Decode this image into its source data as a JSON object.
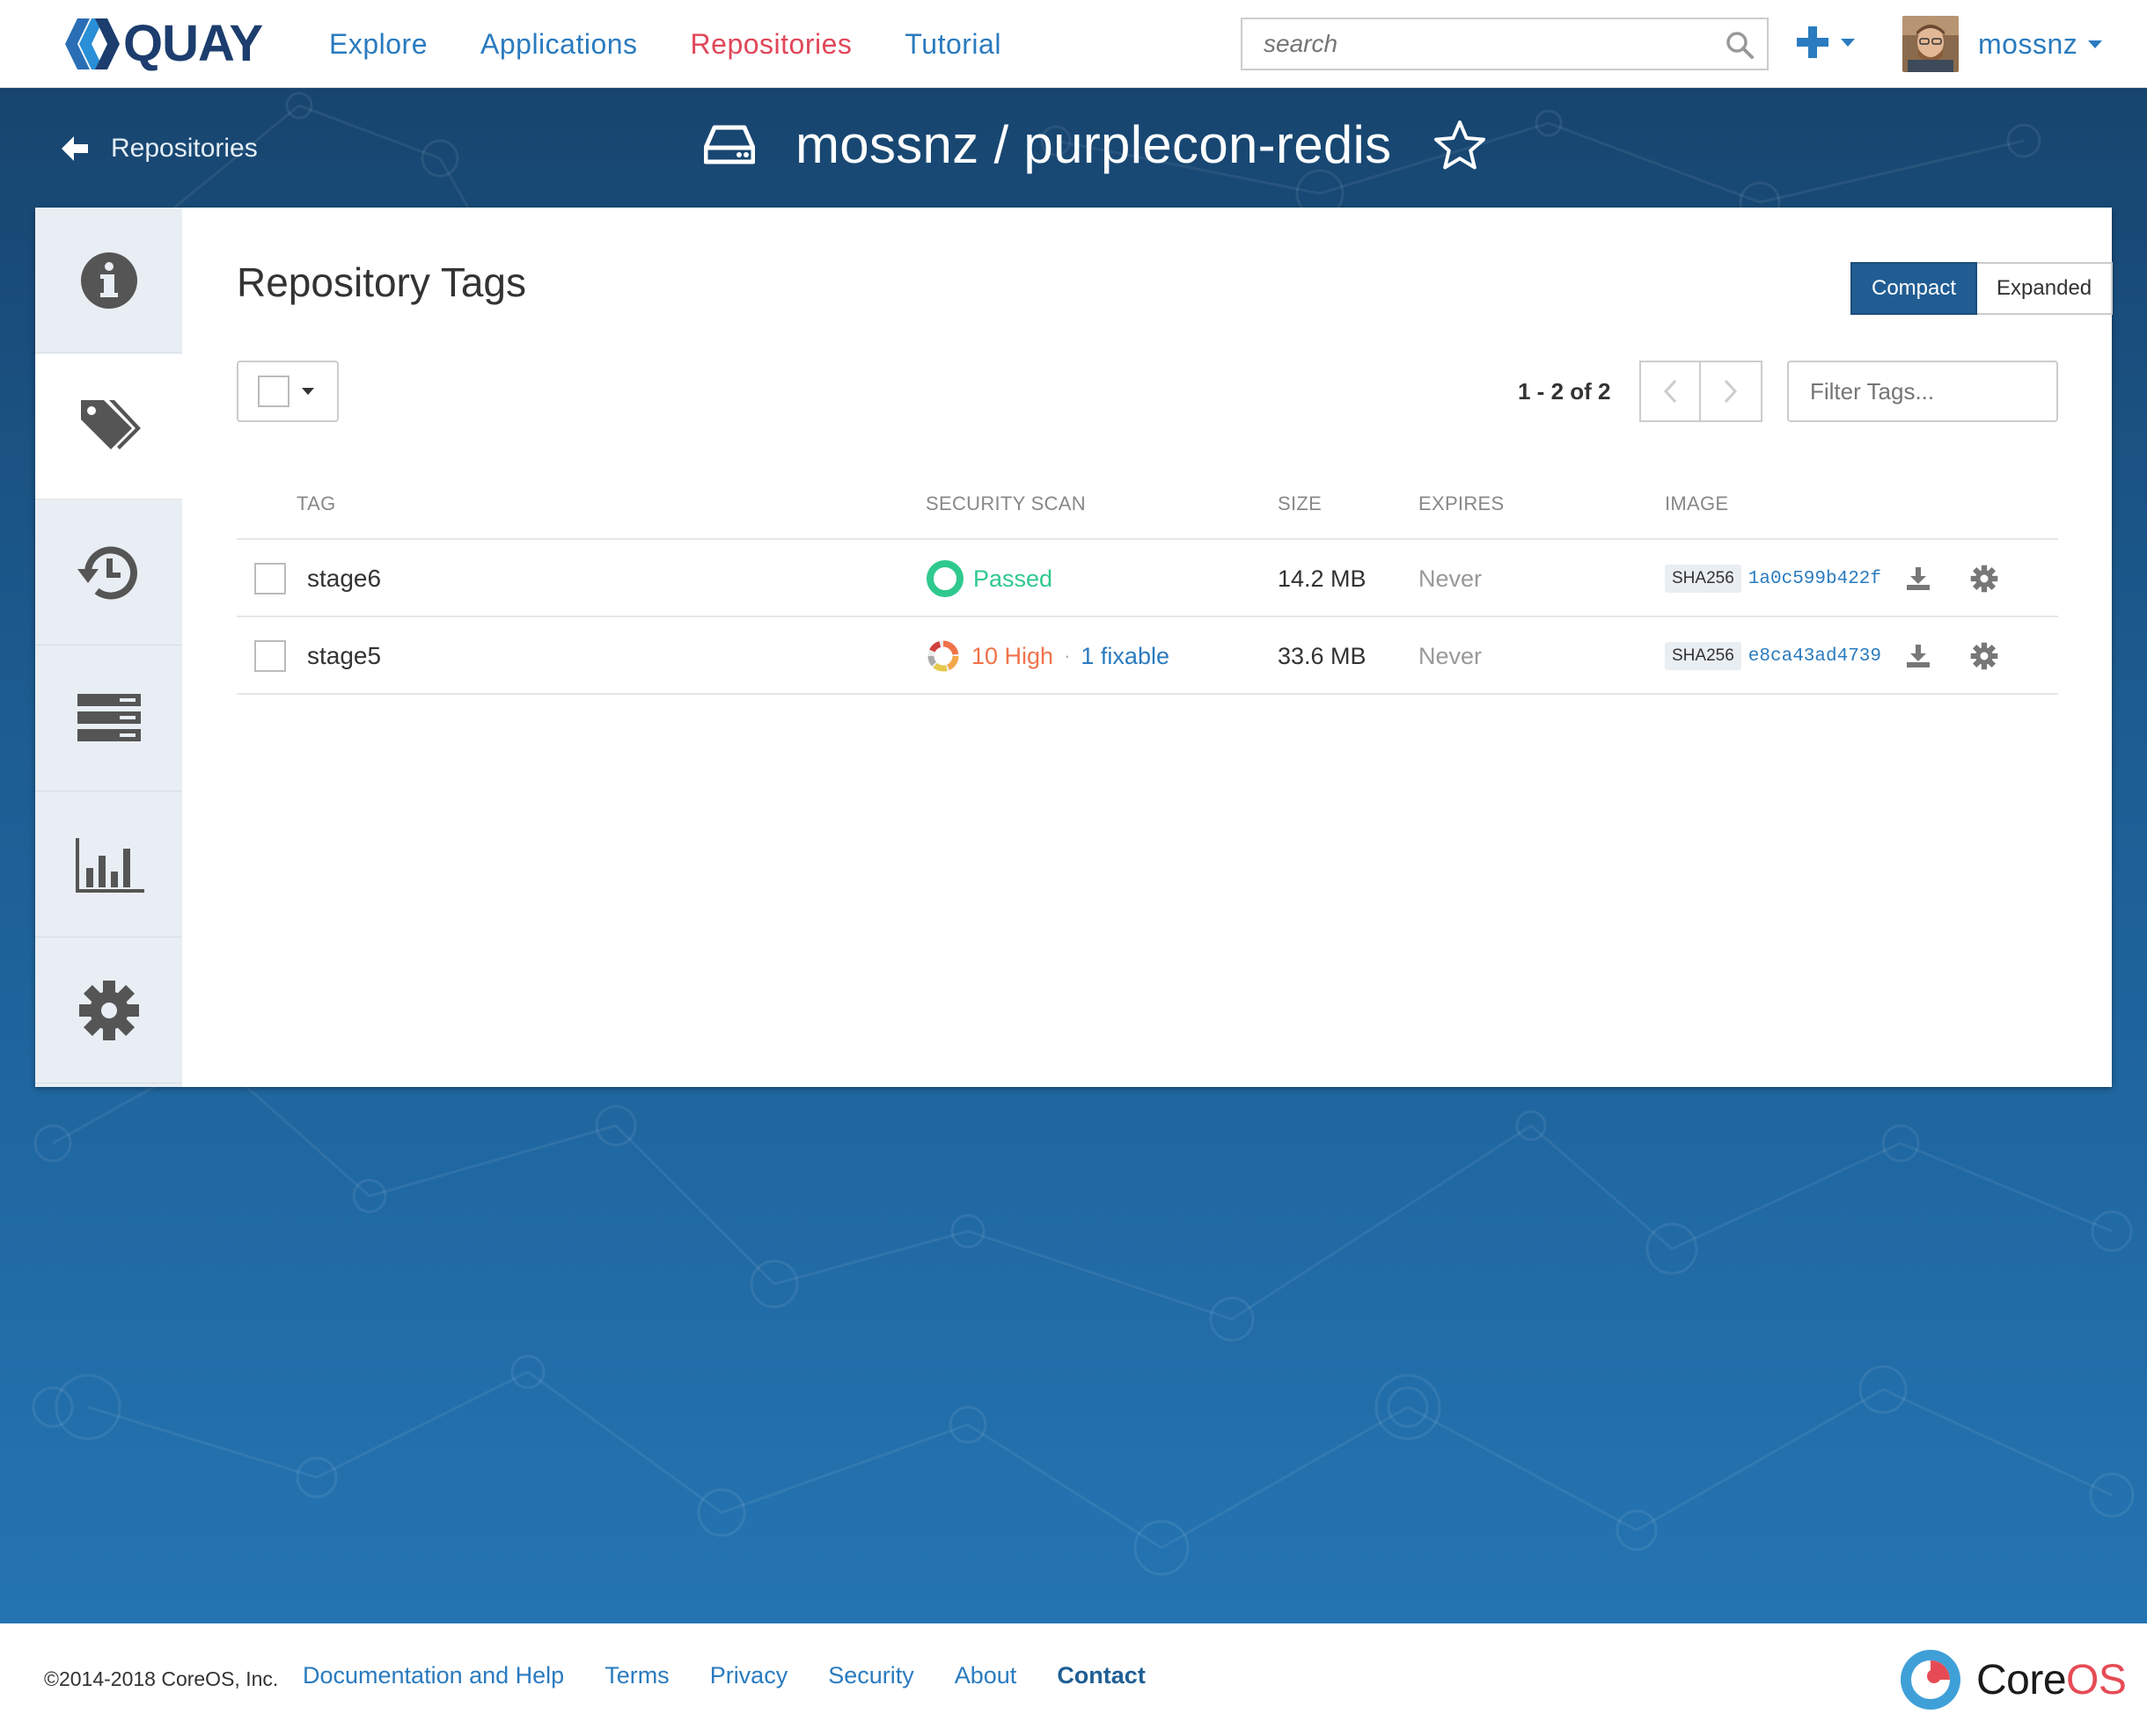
{
  "navbar": {
    "logo_text": "QUAY",
    "links": [
      {
        "label": "Explore",
        "active": false
      },
      {
        "label": "Applications",
        "active": false
      },
      {
        "label": "Repositories",
        "active": true
      },
      {
        "label": "Tutorial",
        "active": false
      }
    ],
    "search_placeholder": "search",
    "create_icon": "plus-icon",
    "user_name": "mossnz"
  },
  "header": {
    "back_label": "Repositories",
    "repo_title": "mossnz / purplecon-redis",
    "repo_icon": "hdd-icon",
    "star_icon": "star-outline-icon"
  },
  "sidebar": {
    "items": [
      {
        "icon": "info-icon",
        "active": false
      },
      {
        "icon": "tags-icon",
        "active": true
      },
      {
        "icon": "history-icon",
        "active": false
      },
      {
        "icon": "builds-icon",
        "active": false
      },
      {
        "icon": "usage-chart-icon",
        "active": false
      },
      {
        "icon": "gear-icon",
        "active": false
      }
    ]
  },
  "tags_panel": {
    "title": "Repository Tags",
    "view_compact": "Compact",
    "view_expanded": "Expanded",
    "paging": "1 - 2 of 2",
    "filter_placeholder": "Filter Tags...",
    "columns": [
      "TAG",
      "SECURITY SCAN",
      "SIZE",
      "EXPIRES",
      "IMAGE"
    ],
    "rows": [
      {
        "tag": "stage6",
        "scan_status": "passed",
        "scan_label": "Passed",
        "size": "14.2 MB",
        "expires": "Never",
        "sha_label": "SHA256",
        "image_id": "1a0c599b422f"
      },
      {
        "tag": "stage5",
        "scan_status": "vulnerable",
        "scan_label": "10 High",
        "scan_separator": "·",
        "scan_fixable": "1 fixable",
        "size": "33.6 MB",
        "expires": "Never",
        "sha_label": "SHA256",
        "image_id": "e8ca43ad4739"
      }
    ]
  },
  "footer": {
    "copyright": "©2014-2018 CoreOS, Inc.",
    "links": [
      "Documentation and Help",
      "Terms",
      "Privacy",
      "Security",
      "About",
      "Contact"
    ],
    "brand_core": "Core",
    "brand_os": "OS"
  },
  "colors": {
    "brand_blue": "#2a7bbf",
    "active_red": "#e0475a",
    "passed_green": "#2fc98e",
    "high_orange": "#f0724a",
    "hero_dark": "#17456f",
    "hero_light": "#2474b2"
  }
}
